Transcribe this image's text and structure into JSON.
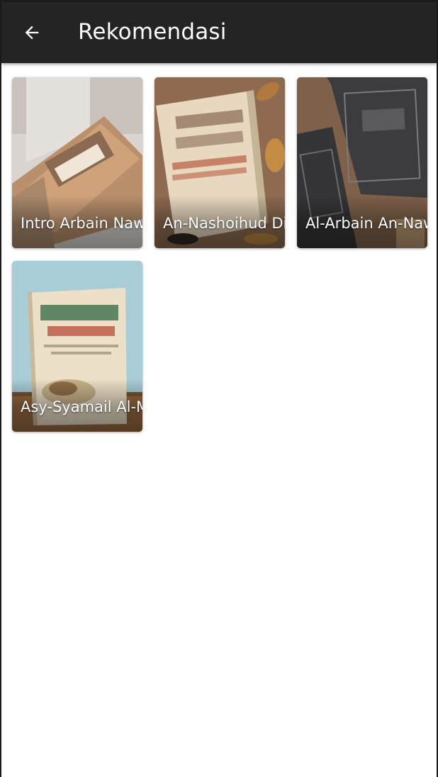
{
  "app_bar": {
    "title": "Rekomendasi",
    "back_icon": "arrow-left-icon",
    "background": "#242424"
  },
  "books": [
    {
      "title": "Intro Arbain Nawawi",
      "cover_icon": "book-cover-image"
    },
    {
      "title": "An-Nashoihud Diniyyah",
      "cover_icon": "book-cover-image"
    },
    {
      "title": "Al-Arbain An-Nawawiyyah",
      "cover_icon": "book-cover-image"
    },
    {
      "title": "Asy-Syamail Al-Muhammadiyah",
      "cover_icon": "book-cover-image"
    }
  ]
}
